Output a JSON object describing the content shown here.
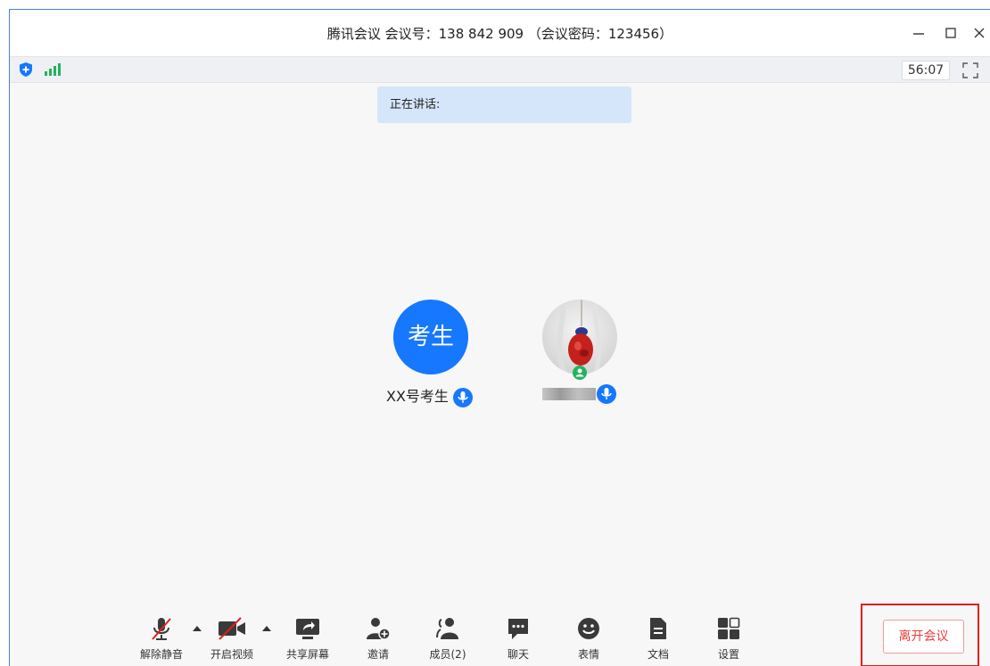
{
  "window": {
    "title": "腾讯会议 会议号：138 842 909 （会议密码：123456）"
  },
  "statusbar": {
    "timer": "56:07",
    "shield_icon": "shield-icon",
    "signal_icon": "signal-icon"
  },
  "speaking": {
    "label": "正在讲话:"
  },
  "participants": [
    {
      "avatar_text": "考生",
      "name": "XX号考生"
    },
    {
      "avatar_text": "",
      "name": ""
    }
  ],
  "toolbar": {
    "items": [
      {
        "label": "解除静音",
        "icon": "mic-muted-icon"
      },
      {
        "label": "开启视频",
        "icon": "video-off-icon"
      },
      {
        "label": "共享屏幕",
        "icon": "share-screen-icon"
      },
      {
        "label": "邀请",
        "icon": "invite-icon"
      },
      {
        "label": "成员(2)",
        "icon": "members-icon"
      },
      {
        "label": "聊天",
        "icon": "chat-icon"
      },
      {
        "label": "表情",
        "icon": "emoji-icon"
      },
      {
        "label": "文档",
        "icon": "document-icon"
      },
      {
        "label": "设置",
        "icon": "settings-icon"
      }
    ],
    "leave_label": "离开会议"
  },
  "colors": {
    "accent_blue": "#1677ff",
    "leave_red": "#e8413d",
    "highlight_red": "#e0201c",
    "speaking_bg": "#d6e6fa"
  }
}
